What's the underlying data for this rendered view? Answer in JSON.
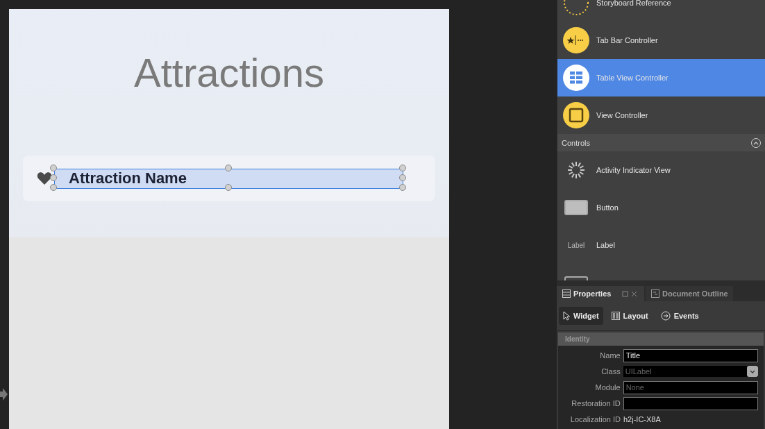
{
  "canvas": {
    "title": "Attractions",
    "label": "Attraction Name",
    "label_selected": true
  },
  "library": {
    "objects": [
      {
        "kind": "storyboard",
        "label": "Storyboard Reference",
        "selected": false
      },
      {
        "kind": "tabbar",
        "label": "Tab Bar Controller",
        "selected": false
      },
      {
        "kind": "table",
        "label": "Table View Controller",
        "selected": true
      },
      {
        "kind": "view",
        "label": "View Controller",
        "selected": false
      }
    ],
    "section": {
      "title": "Controls",
      "expanded": true
    },
    "controls": [
      {
        "kind": "activity",
        "label": "Activity Indicator View",
        "selected": false
      },
      {
        "kind": "button",
        "label": "Button",
        "selected": false
      },
      {
        "kind": "label",
        "icon_text": "Label",
        "label": "Label",
        "selected": false
      },
      {
        "kind": "frame",
        "selected": false
      }
    ]
  },
  "inspector": {
    "tabs": [
      {
        "label": "Properties",
        "selected": true
      },
      {
        "label": "Document Outline",
        "selected": false
      }
    ],
    "modes": [
      {
        "kind": "widget",
        "label": "Widget",
        "selected": true
      },
      {
        "kind": "layout",
        "label": "Layout",
        "selected": false
      },
      {
        "kind": "events",
        "label": "Events",
        "selected": false
      }
    ],
    "section": "Identity",
    "fields": [
      {
        "kind": "text",
        "label": "Name",
        "value": "Title"
      },
      {
        "kind": "select",
        "label": "Class",
        "placeholder": "UILabel"
      },
      {
        "kind": "text",
        "label": "Module",
        "placeholder": "None"
      },
      {
        "kind": "text",
        "label": "Restoration ID"
      },
      {
        "kind": "static",
        "label": "Localization ID",
        "value": "h2j-IC-X8A"
      }
    ]
  }
}
